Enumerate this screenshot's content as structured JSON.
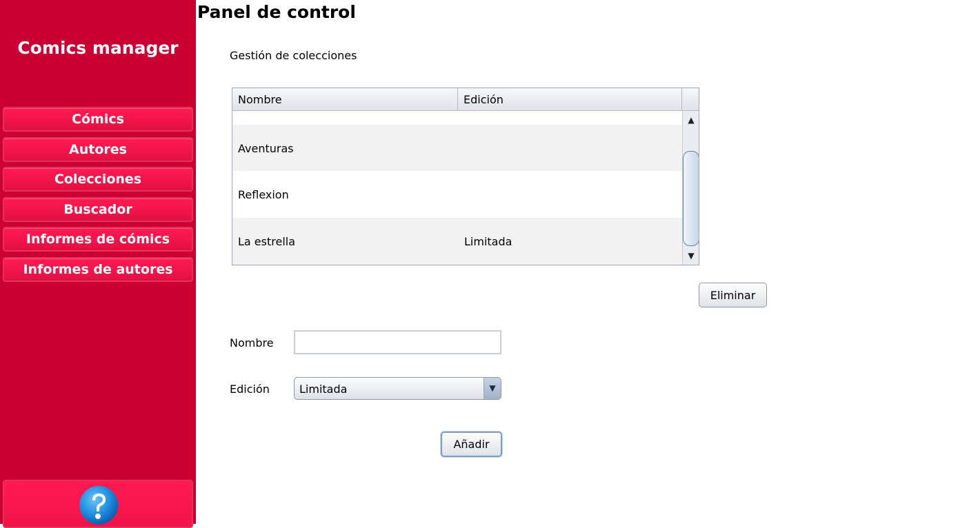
{
  "app": {
    "title": "Comics manager"
  },
  "sidebar": {
    "items": [
      {
        "label": "Cómics"
      },
      {
        "label": "Autores"
      },
      {
        "label": "Colecciones"
      },
      {
        "label": "Buscador"
      },
      {
        "label": "Informes de cómics"
      },
      {
        "label": "Informes de autores"
      }
    ],
    "help_icon": "question-mark-icon"
  },
  "main": {
    "title": "Panel de control",
    "section_label": "Gestión de colecciones",
    "table": {
      "columns": [
        "Nombre",
        "Edición"
      ],
      "rows": [
        {
          "nombre": "Aventuras",
          "edicion": ""
        },
        {
          "nombre": "Reflexion",
          "edicion": ""
        },
        {
          "nombre": "La estrella",
          "edicion": "Limitada"
        }
      ]
    },
    "delete_button": "Eliminar",
    "form": {
      "name_label": "Nombre",
      "name_value": "",
      "edition_label": "Edición",
      "edition_selected": "Limitada",
      "add_button": "Añadir"
    }
  },
  "colors": {
    "sidebar_bg": "#cc0033",
    "nav_button": "#f01449"
  }
}
